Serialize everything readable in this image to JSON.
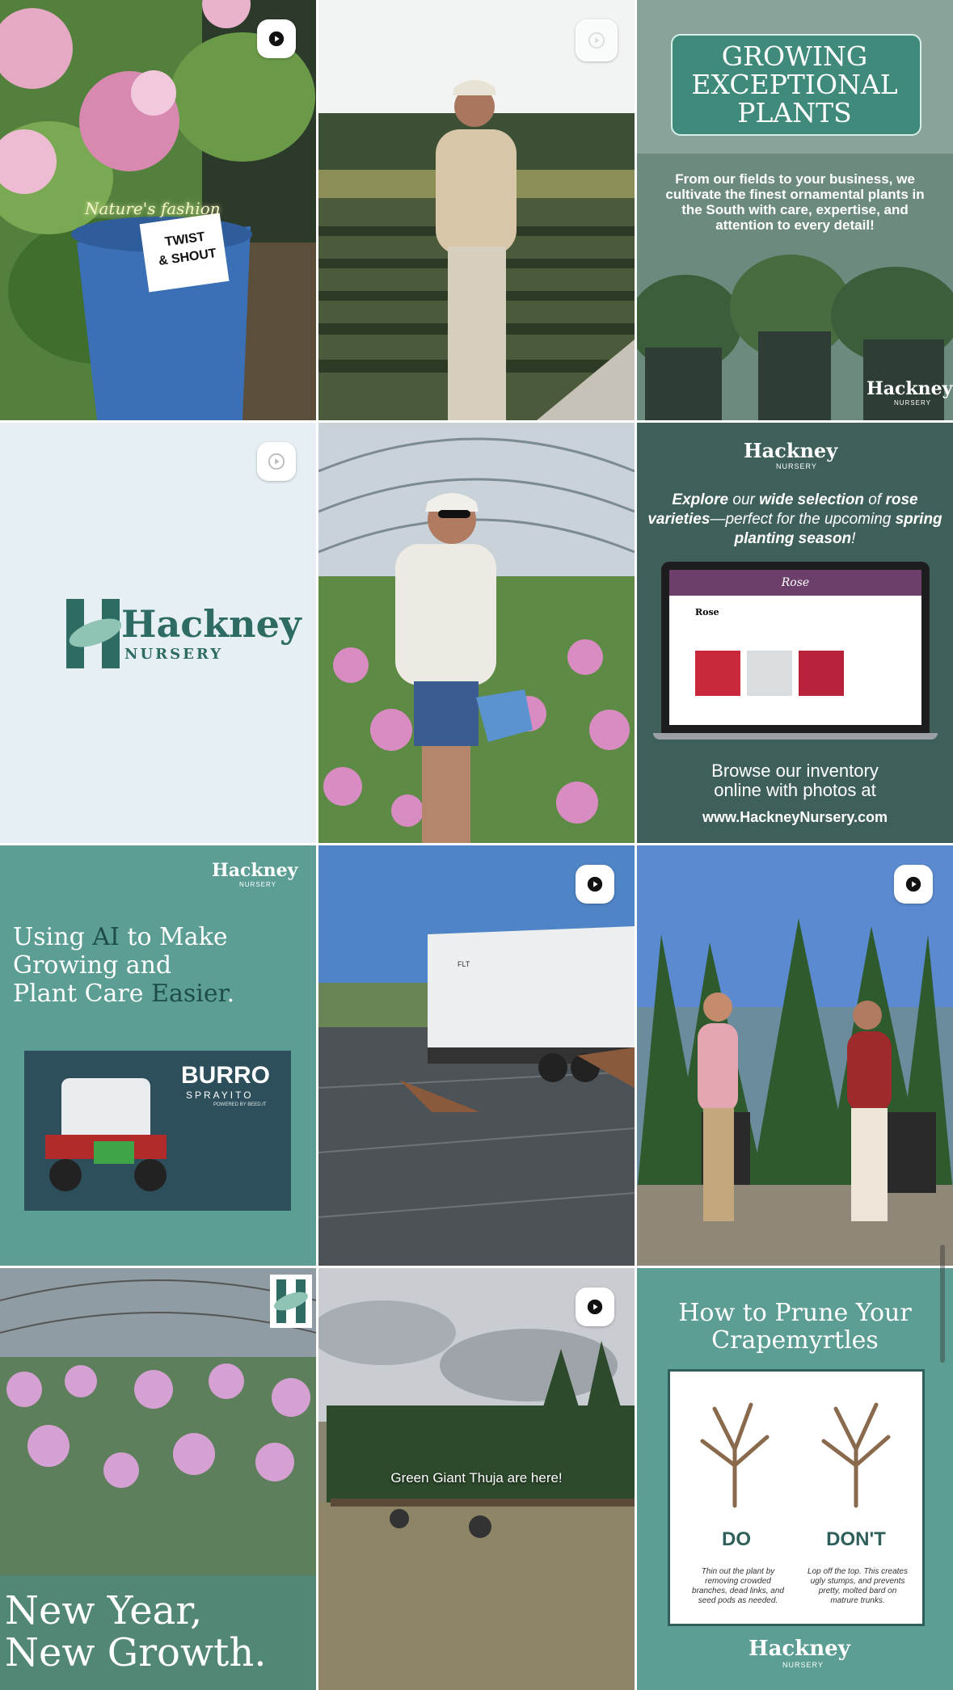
{
  "colors": {
    "teal": "#5c9e94",
    "tealDark": "#2f5f5a",
    "brandGreen": "#2e6b63",
    "lightBlue": "#e6f0f4"
  },
  "posts": [
    {
      "type": "reel",
      "caption": "Nature's fashion",
      "tag_line1": "TWIST",
      "tag_line2": "& SHOUT",
      "icon": "play-icon"
    },
    {
      "type": "reel",
      "icon": "play-icon"
    },
    {
      "type": "image",
      "heading_line1": "GROWING",
      "heading_line2": "EXCEPTIONAL",
      "heading_line3": "PLANTS",
      "body": "From our fields to your business, we cultivate the finest ornamental plants in the South with care, expertise, and attention to every detail!",
      "logo": "Hackney",
      "logo_sub": "NURSERY"
    },
    {
      "type": "reel",
      "logo": "Hackney",
      "logo_sub": "NURSERY",
      "icon": "play-icon"
    },
    {
      "type": "image"
    },
    {
      "type": "image",
      "logo": "Hackney",
      "logo_sub": "NURSERY",
      "headline_a": "Explore",
      "headline_b": " our ",
      "headline_c": "wide selection",
      "headline_d": " of ",
      "headline_e": "rose varieties",
      "headline_f": "—perfect for the upcoming ",
      "headline_g": "spring planting season",
      "headline_h": "!",
      "screen_title": "Rose",
      "screen_heading": "Rose",
      "footer_line1": "Browse our inventory",
      "footer_line2": "online with photos at",
      "footer_url": "www.HackneyNursery.com"
    },
    {
      "type": "image",
      "logo": "Hackney",
      "logo_sub": "NURSERY",
      "headline_1": "Using ",
      "headline_ai": "AI",
      "headline_2": " to Make",
      "headline_3": "Growing and",
      "headline_4": "Plant Care ",
      "headline_easier": "Easier",
      "headline_5": ".",
      "burro": "BURRO",
      "burro_sub": "SPRAYITO",
      "burro_tag": "POWERED BY BEED.IT"
    },
    {
      "type": "reel",
      "truck_label": "FLT",
      "icon": "play-icon"
    },
    {
      "type": "reel",
      "icon": "play-icon"
    },
    {
      "type": "image",
      "heading_1": "New Year,",
      "heading_2": "New Growth."
    },
    {
      "type": "reel",
      "caption": "Green Giant Thuja are here!",
      "icon": "play-icon"
    },
    {
      "type": "image",
      "heading_1": "How to Prune Your",
      "heading_2": "Crapemyrtles",
      "do": "DO",
      "do_text": "Thin out the plant by removing crowded branches, dead links, and seed pods as needed.",
      "dont": "DON'T",
      "dont_text": "Lop off the top. This creates ugly stumps, and prevents pretty, molted bard on matrure trunks.",
      "logo": "Hackney",
      "logo_sub": "NURSERY"
    }
  ]
}
